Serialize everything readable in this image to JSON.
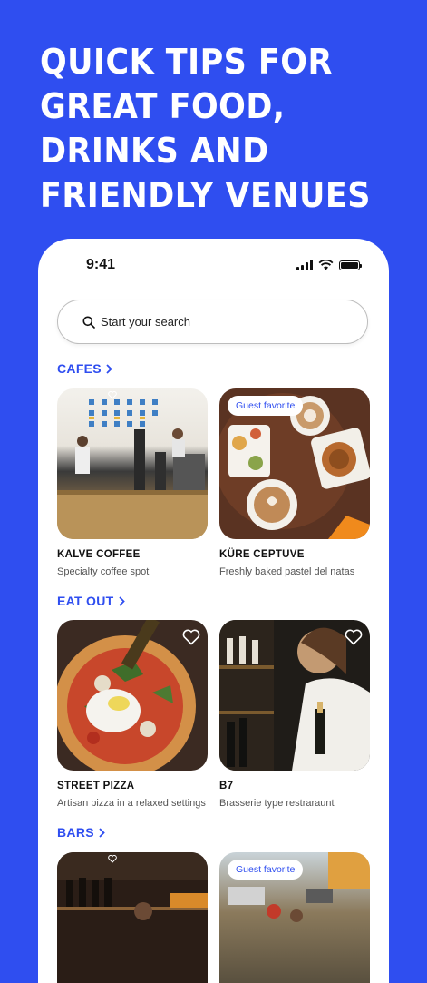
{
  "headline": "QUICK TIPS FOR GREAT FOOD, DRINKS AND FRIENDLY VENUES",
  "status": {
    "time": "9:41"
  },
  "search": {
    "placeholder": "Start your search"
  },
  "sections": [
    {
      "title": "CAFES",
      "cards": [
        {
          "title": "KALVE COFFEE",
          "subtitle": "Specialty coffee spot",
          "badge": ""
        },
        {
          "title": "KÜRE CEPTUVE",
          "subtitle": "Freshly baked pastel del natas",
          "badge": "Guest favorite"
        }
      ]
    },
    {
      "title": "EAT OUT",
      "cards": [
        {
          "title": "STREET PIZZA",
          "subtitle": "Artisan pizza in a relaxed settings",
          "badge": ""
        },
        {
          "title": "B7",
          "subtitle": "Brasserie type restraraunt",
          "badge": ""
        }
      ]
    },
    {
      "title": "BARS",
      "cards": [
        {
          "title": "",
          "subtitle": "",
          "badge": ""
        },
        {
          "title": "",
          "subtitle": "",
          "badge": "Guest favorite"
        }
      ]
    }
  ],
  "colors": {
    "accent": "#2f4ef0",
    "background": "#2f4ef0"
  }
}
